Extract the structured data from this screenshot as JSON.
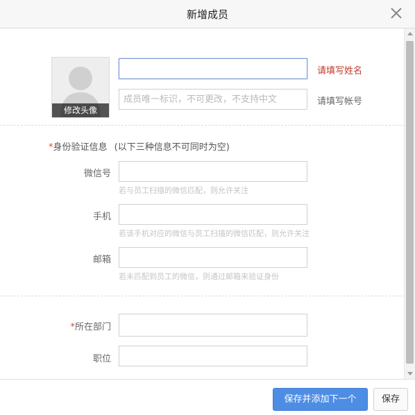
{
  "dialog": {
    "title": "新增成员",
    "close_icon": "close-icon"
  },
  "avatar": {
    "edit_label": "修改头像",
    "icon": "person-silhouette-icon"
  },
  "name": {
    "value": "",
    "placeholder": "",
    "hint": "请填写姓名"
  },
  "account": {
    "value": "",
    "placeholder": "成员唯一标识，不可更改，不支持中文",
    "hint": "请填写帐号"
  },
  "identity": {
    "required_mark": "*",
    "title": "身份验证信息",
    "note": "(以下三种信息不可同时为空)"
  },
  "wechat": {
    "label": "微信号",
    "value": "",
    "help": "若与员工扫描的微信匹配，则允许关注"
  },
  "phone": {
    "label": "手机",
    "value": "",
    "help": "若该手机对应的微信与员工扫描的微信匹配，则允许关注"
  },
  "email": {
    "label": "邮箱",
    "value": "",
    "help": "若未匹配到员工的微信，则通过邮箱来验证身份"
  },
  "department": {
    "required_mark": "*",
    "label": "所在部门",
    "value": ""
  },
  "position": {
    "label": "职位",
    "value": ""
  },
  "footer": {
    "save_add_next": "保存并添加下一个",
    "save": "保存"
  },
  "colors": {
    "accent": "#4e8de4",
    "required": "#d14c36",
    "error_hint": "#c0392b"
  }
}
